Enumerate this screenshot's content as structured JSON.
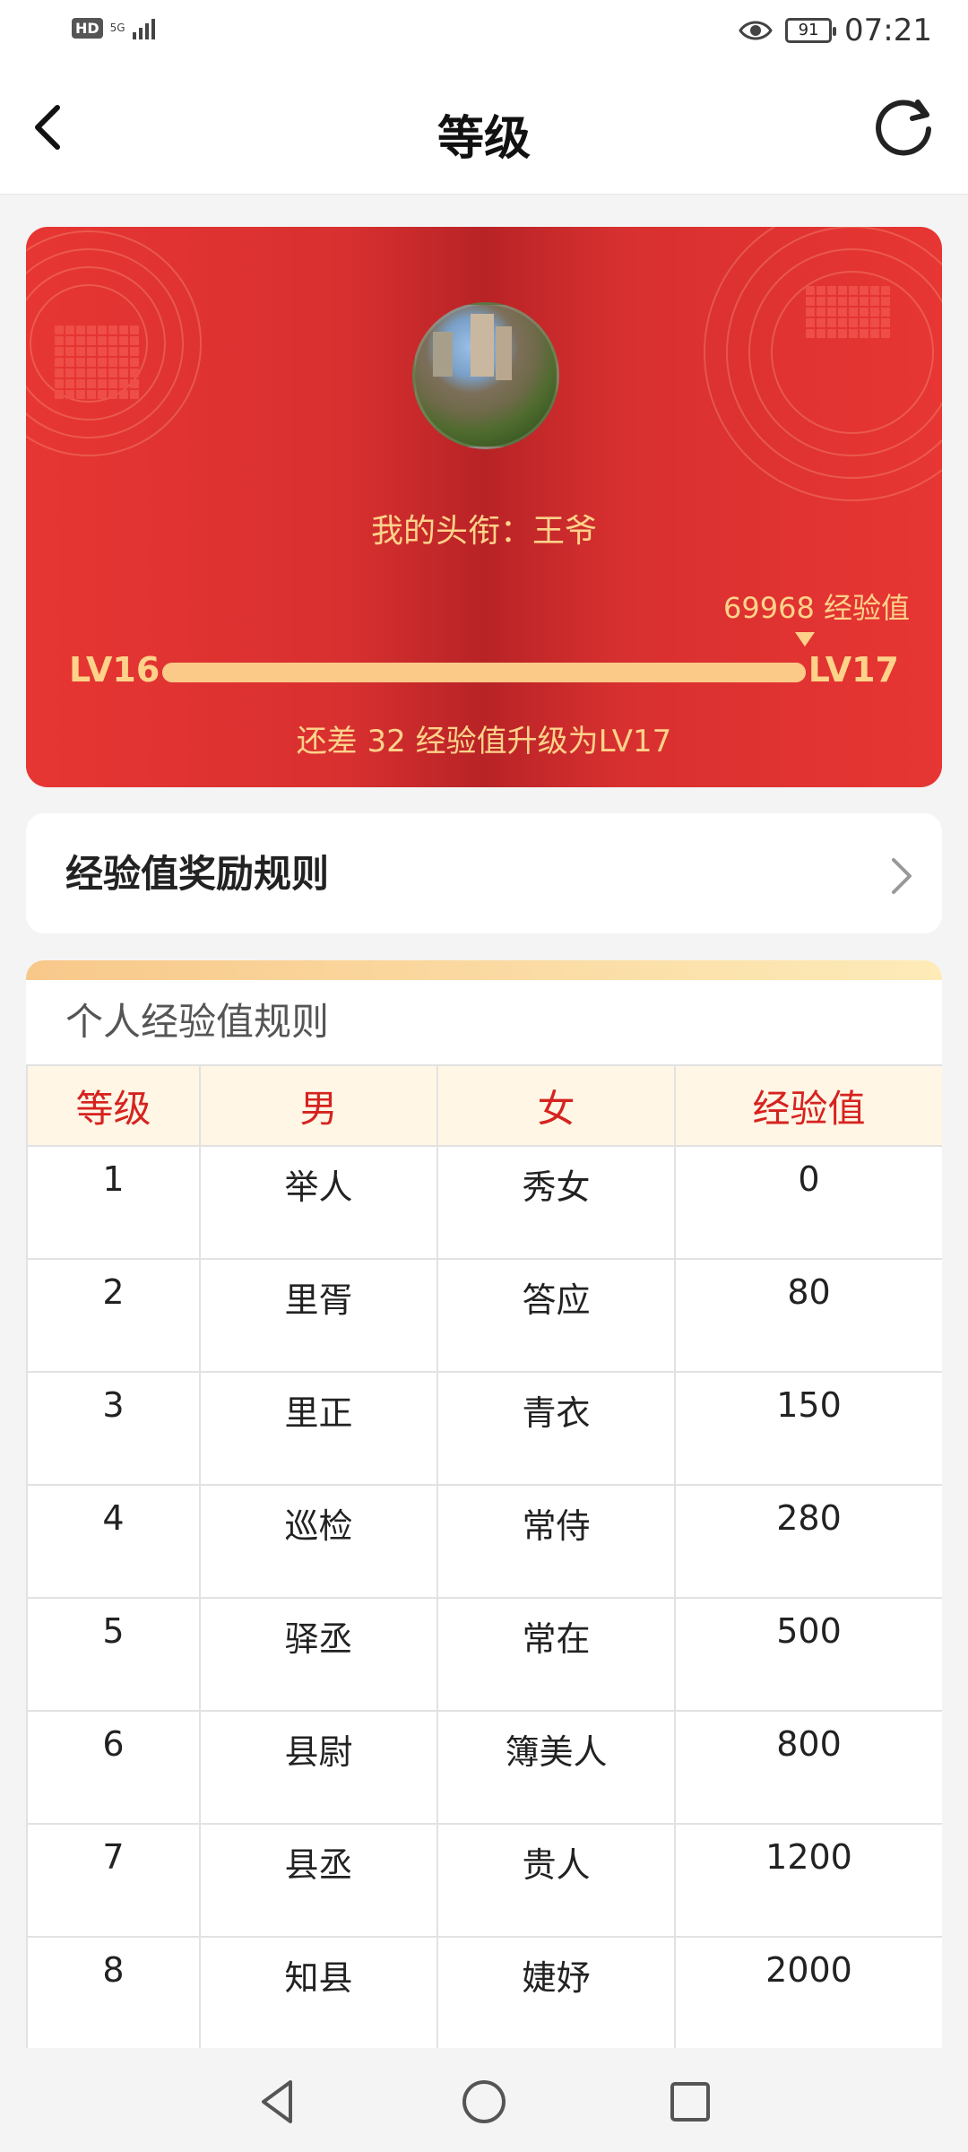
{
  "status_bar": {
    "network": "HD",
    "signal_label": "5G",
    "battery": "91",
    "time": "07:21"
  },
  "header": {
    "title": "等级"
  },
  "level_card": {
    "title_text": "我的头衔：王爷",
    "exp_value_text": "69968 经验值",
    "current_level": "LV16",
    "next_level": "LV17",
    "progress": 1.0,
    "need_text": "还差 32 经验值升级为LV17",
    "accent_color": "#ffd28a"
  },
  "rules_link": {
    "label": "经验值奖励规则"
  },
  "rules_table": {
    "section_title": "个人经验值规则",
    "columns": [
      "等级",
      "男",
      "女",
      "经验值"
    ],
    "rows": [
      [
        "1",
        "举人",
        "秀女",
        "0"
      ],
      [
        "2",
        "里胥",
        "答应",
        "80"
      ],
      [
        "3",
        "里正",
        "青衣",
        "150"
      ],
      [
        "4",
        "巡检",
        "常侍",
        "280"
      ],
      [
        "5",
        "驿丞",
        "常在",
        "500"
      ],
      [
        "6",
        "县尉",
        "簿美人",
        "800"
      ],
      [
        "7",
        "县丞",
        "贵人",
        "1200"
      ],
      [
        "8",
        "知县",
        "婕妤",
        "2000"
      ]
    ]
  },
  "nav_bar": {
    "icons": [
      "back-triangle-icon",
      "home-circle-icon",
      "recents-square-icon"
    ]
  }
}
